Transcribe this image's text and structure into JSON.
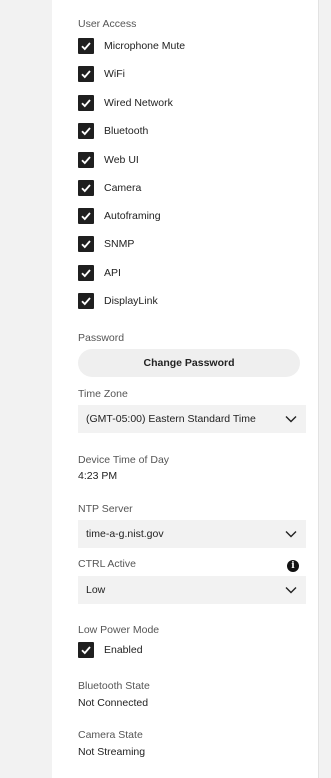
{
  "user_access": {
    "label": "User Access",
    "items": [
      {
        "label": "Microphone Mute",
        "checked": true
      },
      {
        "label": "WiFi",
        "checked": true
      },
      {
        "label": "Wired Network",
        "checked": true
      },
      {
        "label": "Bluetooth",
        "checked": true
      },
      {
        "label": "Web UI",
        "checked": true
      },
      {
        "label": "Camera",
        "checked": true
      },
      {
        "label": "Autoframing",
        "checked": true
      },
      {
        "label": "SNMP",
        "checked": true
      },
      {
        "label": "API",
        "checked": true
      },
      {
        "label": "DisplayLink",
        "checked": true
      }
    ]
  },
  "password": {
    "label": "Password",
    "button_label": "Change Password"
  },
  "time_zone": {
    "label": "Time Zone",
    "value": "(GMT-05:00) Eastern Standard Time"
  },
  "device_time": {
    "label": "Device Time of Day",
    "value": "4:23 PM"
  },
  "ntp_server": {
    "label": "NTP Server",
    "value": "time-a-g.nist.gov"
  },
  "ctrl_active": {
    "label": "CTRL Active",
    "info_glyph": "i",
    "value": "Low"
  },
  "low_power_mode": {
    "label": "Low Power Mode",
    "option_label": "Enabled",
    "checked": true
  },
  "bluetooth_state": {
    "label": "Bluetooth State",
    "value": "Not Connected"
  },
  "camera_state": {
    "label": "Camera State",
    "value": "Not Streaming"
  }
}
